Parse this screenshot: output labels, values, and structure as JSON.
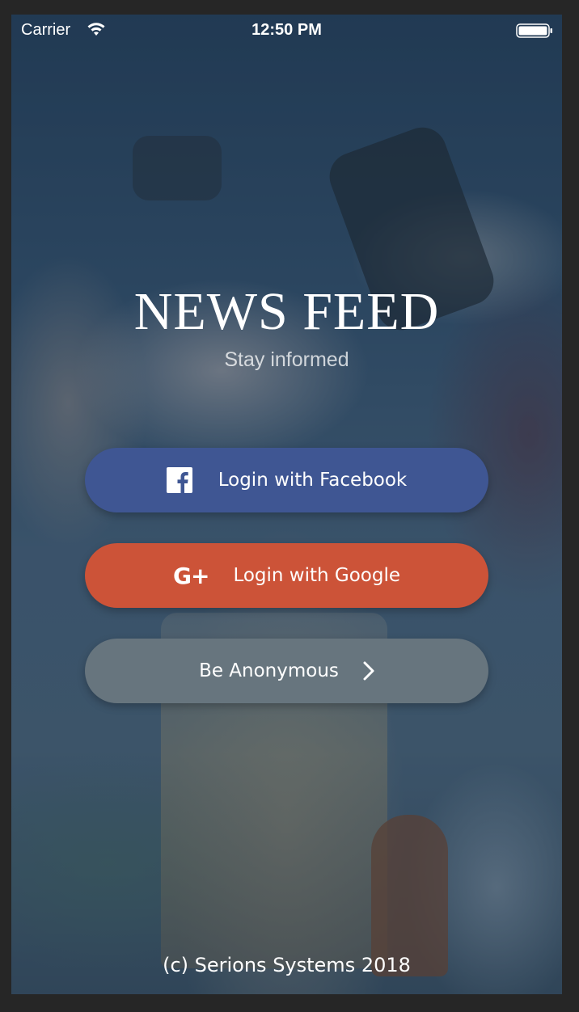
{
  "status_bar": {
    "carrier": "Carrier",
    "time": "12:50 PM"
  },
  "header": {
    "title": "NEWS FEED",
    "subtitle": "Stay informed"
  },
  "buttons": {
    "facebook": {
      "label": "Login with Facebook",
      "icon": "facebook-icon",
      "color": "#3f5693"
    },
    "google": {
      "label": "Login with Google",
      "icon": "google-plus-icon",
      "icon_text": "G+",
      "color": "#cc5338"
    },
    "anonymous": {
      "label": "Be Anonymous",
      "icon": "chevron-right-icon",
      "color": "#67757e"
    }
  },
  "footer": {
    "copyright": "(c) Serions Systems 2018"
  }
}
